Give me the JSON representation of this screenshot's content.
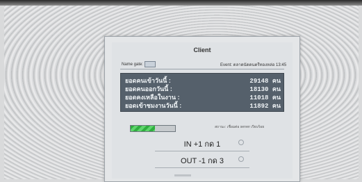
{
  "window": {
    "title": "Client"
  },
  "header": {
    "name_label": "Name gate:",
    "name_value": "",
    "event_label": "Event: ตลาดนัดดนตรีทองหล่อ 13:45"
  },
  "stats": [
    {
      "label": "ยอดคนเข้าวันนี้ :",
      "value": "29148 คน"
    },
    {
      "label": "ยอดคนออกวันนี้ :",
      "value": "18130 คน"
    },
    {
      "label": "ยอดคงเหลือในงาน :",
      "value": "11018 คน"
    },
    {
      "label": "ยอดเข้าชมงานวันนี้ :",
      "value": "11892 คน"
    }
  ],
  "progress": {
    "value": 0.55,
    "note": "สถานะ: เชื่อมต่อ server เรียบร้อย"
  },
  "actions": [
    {
      "label": "IN +1 กด 1"
    },
    {
      "label": "OUT -1 กด 3"
    }
  ],
  "colors": {
    "panel_bg": "#55606b",
    "progress_fill": "#2fae3f",
    "dialog_bg": "#e4e6e8"
  }
}
